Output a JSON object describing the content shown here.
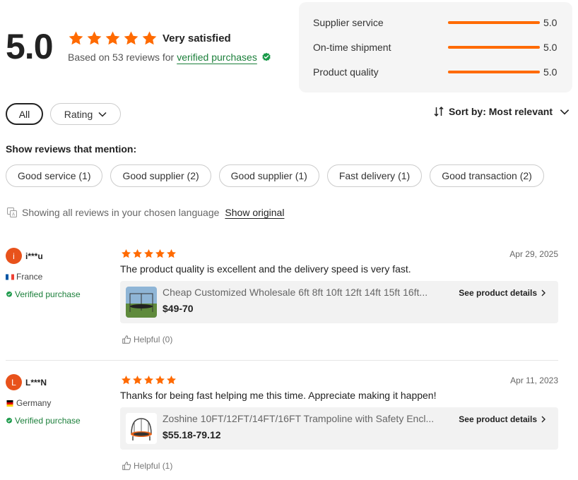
{
  "summary": {
    "score": "5.0",
    "label": "Very satisfied",
    "based_on": "Based on 53 reviews for",
    "verified_link": "verified purchases",
    "star_count": 5
  },
  "ratings": [
    {
      "label": "Supplier service",
      "value": "5.0"
    },
    {
      "label": "On-time shipment",
      "value": "5.0"
    },
    {
      "label": "Product quality",
      "value": "5.0"
    }
  ],
  "filters": {
    "all_label": "All",
    "rating_label": "Rating"
  },
  "sort": {
    "label": "Sort by: Most relevant"
  },
  "mentions": {
    "title": "Show reviews that mention:",
    "chips": [
      "Good service (1)",
      "Good supplier (2)",
      "Good supplier (1)",
      "Fast delivery (1)",
      "Good transaction (2)"
    ]
  },
  "language": {
    "text": "Showing all reviews in your chosen language",
    "link": "Show original"
  },
  "reviews": [
    {
      "initial": "i",
      "name": "i***u",
      "country": "France",
      "verified": "Verified purchase",
      "stars": 5,
      "date": "Apr 29, 2025",
      "text": "The product quality is excellent and the delivery speed is very fast.",
      "product_title": "Cheap Customized Wholesale 6ft 8ft 10ft 12ft 14ft 15ft 16ft...",
      "product_price": "$49-70",
      "product_link": "See product details",
      "helpful": "Helpful (0)"
    },
    {
      "initial": "L",
      "name": "L***N",
      "country": "Germany",
      "verified": "Verified purchase",
      "stars": 5,
      "date": "Apr 11, 2023",
      "text": "Thanks for being fast helping me this time. Appreciate making it happen!",
      "product_title": "Zoshine 10FT/12FT/14FT/16FT Trampoline with Safety Encl...",
      "product_price": "$55.18-79.12",
      "product_link": "See product details",
      "helpful": "Helpful (1)"
    }
  ],
  "colors": {
    "accent": "#ff6a00",
    "verified": "#1b7f3a",
    "avatar": "#e8521b"
  }
}
